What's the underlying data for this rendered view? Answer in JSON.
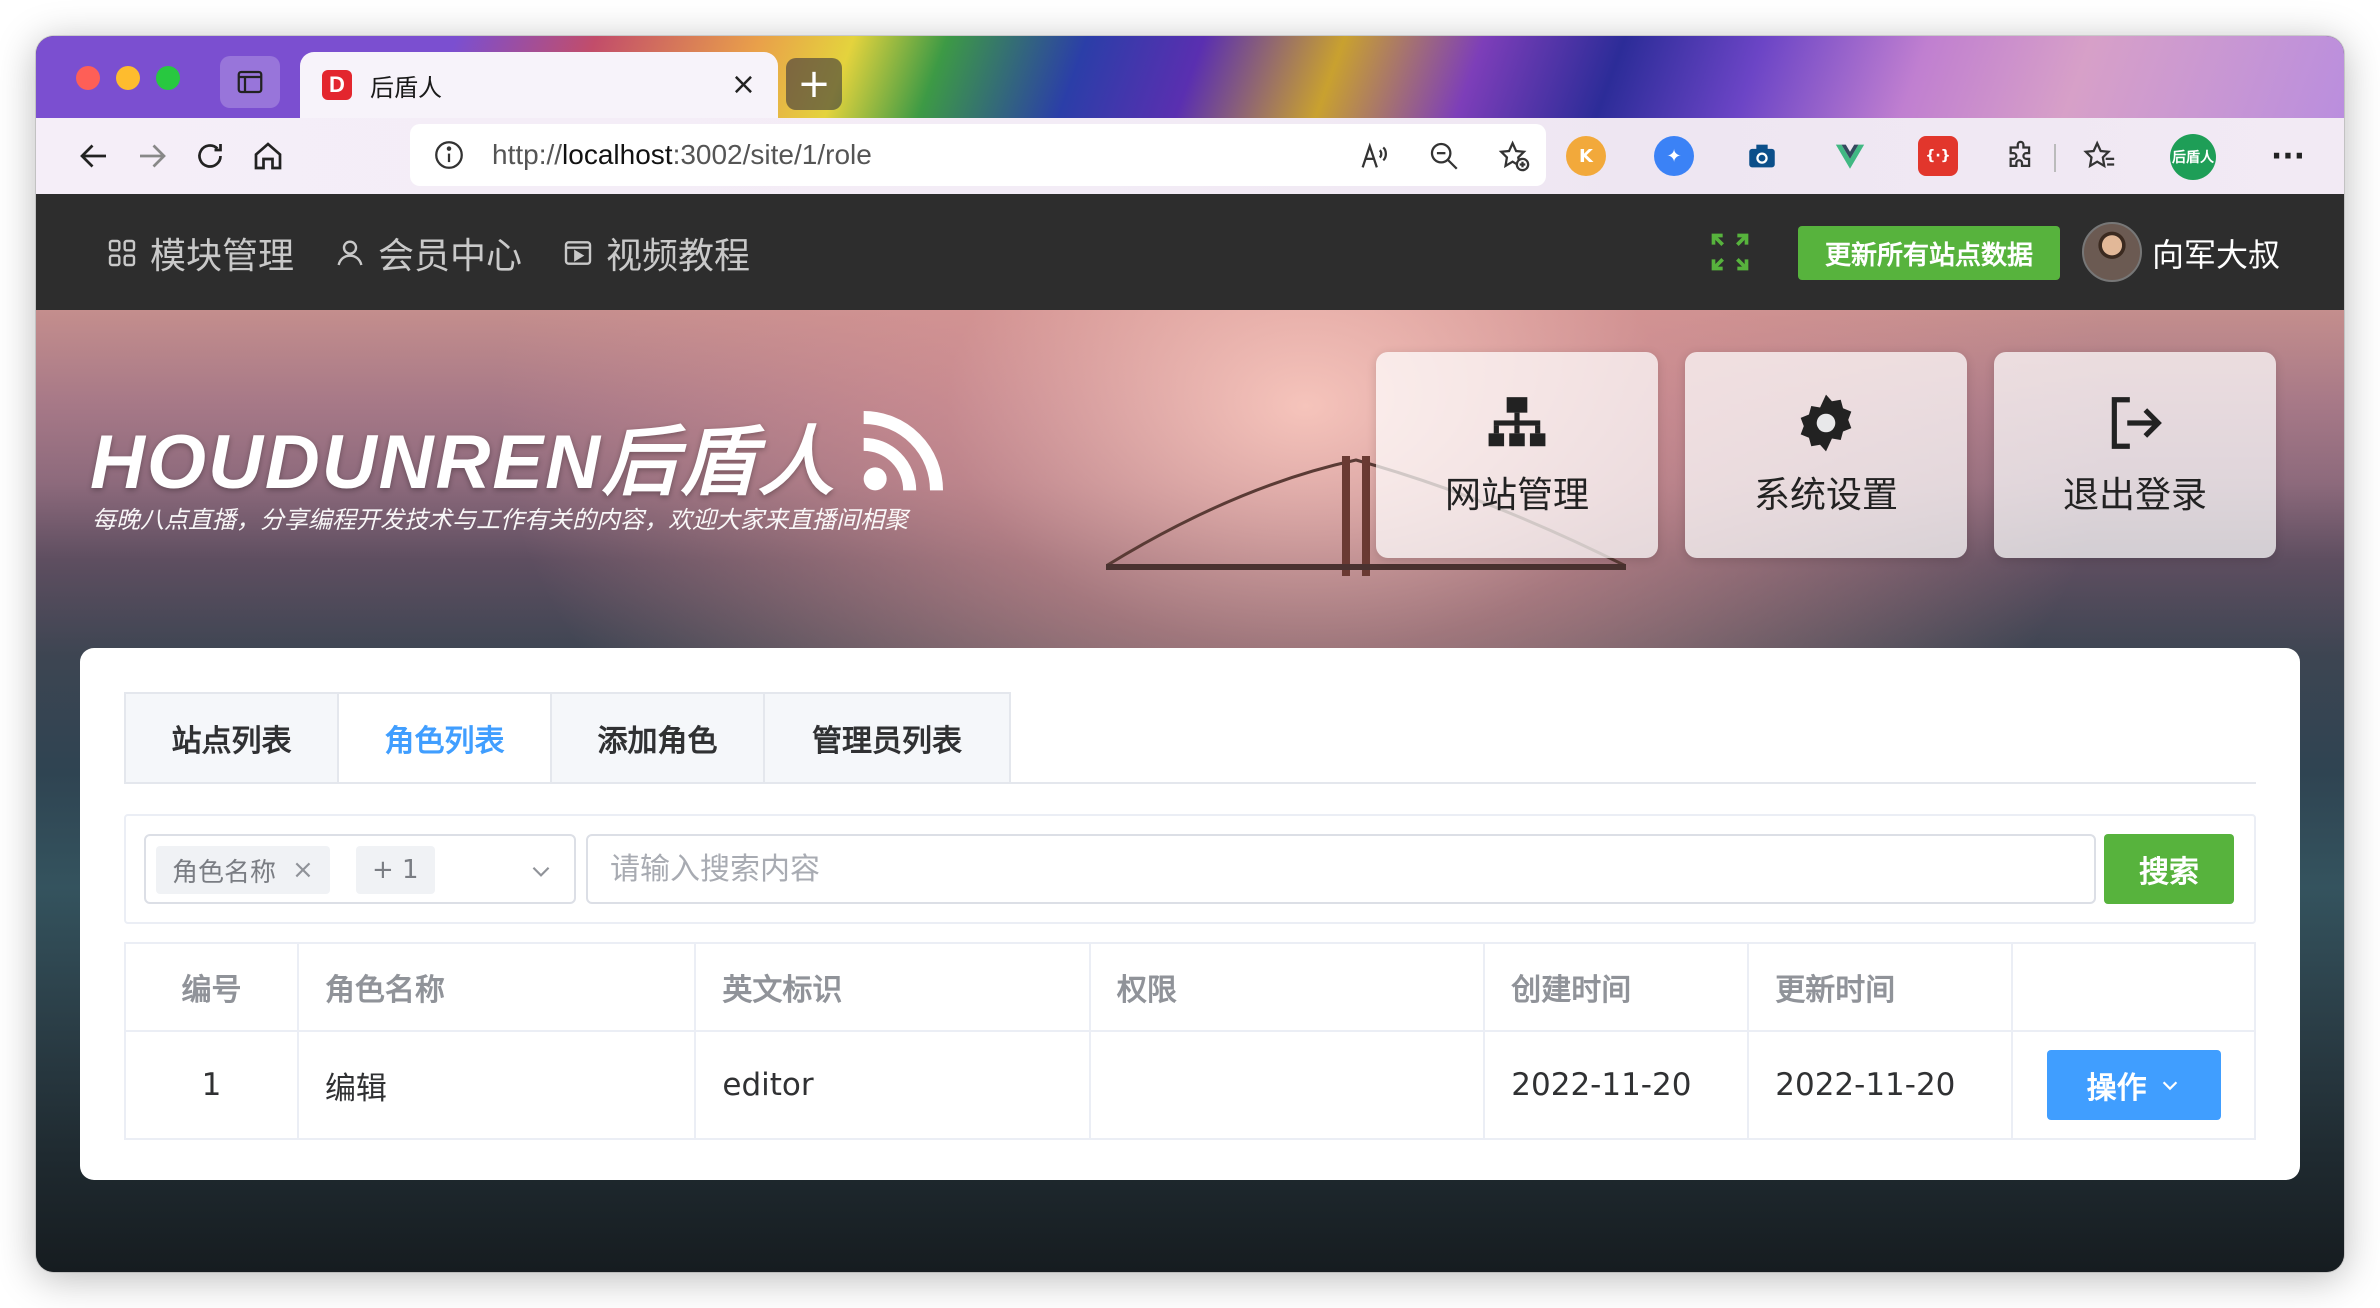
{
  "browser": {
    "tab_title": "后盾人",
    "favicon_letter": "D",
    "url_prefix": "http://",
    "url_host": "localhost",
    "url_rest": ":3002/site/1/role",
    "profile_label": "后盾人"
  },
  "topnav": {
    "items": [
      {
        "label": "模块管理",
        "icon": "grid-icon"
      },
      {
        "label": "会员中心",
        "icon": "user-icon"
      },
      {
        "label": "视频教程",
        "icon": "video-icon"
      }
    ],
    "update_button": "更新所有站点数据",
    "user_name": "向军大叔"
  },
  "banner": {
    "logo_text": "HOUDUNREN后盾人",
    "subtitle": "每晚八点直播，分享编程开发技术与工作有关的内容，欢迎大家来直播间相聚",
    "quick_cards": [
      {
        "label": "网站管理",
        "icon": "sitemap-icon"
      },
      {
        "label": "系统设置",
        "icon": "gear-icon"
      },
      {
        "label": "退出登录",
        "icon": "logout-icon"
      }
    ]
  },
  "tabs": [
    {
      "label": "站点列表",
      "active": false
    },
    {
      "label": "角色列表",
      "active": true
    },
    {
      "label": "添加角色",
      "active": false
    },
    {
      "label": "管理员列表",
      "active": false
    }
  ],
  "search": {
    "chip_label": "角色名称",
    "chip_more": "+ 1",
    "placeholder": "请输入搜索内容",
    "value": "",
    "button": "搜索"
  },
  "table": {
    "columns": [
      "编号",
      "角色名称",
      "英文标识",
      "权限",
      "创建时间",
      "更新时间",
      ""
    ],
    "rows": [
      {
        "id": "1",
        "name": "编辑",
        "slug": "editor",
        "permissions": "",
        "created": "2022-11-20",
        "updated": "2022-11-20",
        "action": "操作"
      }
    ]
  },
  "colors": {
    "primary": "#409eff",
    "success": "#57b33d",
    "nav_bg": "#2d2d2d"
  }
}
